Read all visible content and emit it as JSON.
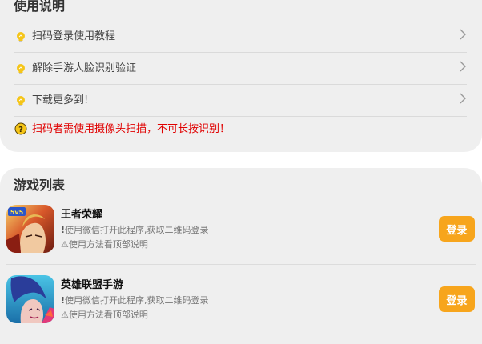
{
  "usage": {
    "title": "使用说明",
    "items": [
      {
        "label": "扫码登录使用教程",
        "icon": "lightbulb-icon"
      },
      {
        "label": "解除手游人脸识别验证",
        "icon": "lightbulb-icon"
      },
      {
        "label": "下载更多到!",
        "icon": "lightbulb-icon"
      }
    ],
    "warning": {
      "text": "扫码者需使用摄像头扫描，不可长按识别！",
      "icon": "question-circle-icon"
    }
  },
  "games": {
    "title": "游戏列表",
    "list": [
      {
        "name": "王者荣耀",
        "desc_mark": "!",
        "desc": "使用微信打开此程序,获取二维码登录",
        "hint": "⚠使用方法看顶部说明",
        "button": "登录",
        "icon_badge": "5v5"
      },
      {
        "name": "英雄联盟手游",
        "desc_mark": "!",
        "desc": "使用微信打开此程序,获取二维码登录",
        "hint": "⚠使用方法看顶部说明",
        "button": "登录"
      }
    ]
  },
  "colors": {
    "card_background": "#efefef",
    "accent_button": "#f7a51c",
    "warning_text": "#e00000",
    "bulb": "#f5c518"
  }
}
